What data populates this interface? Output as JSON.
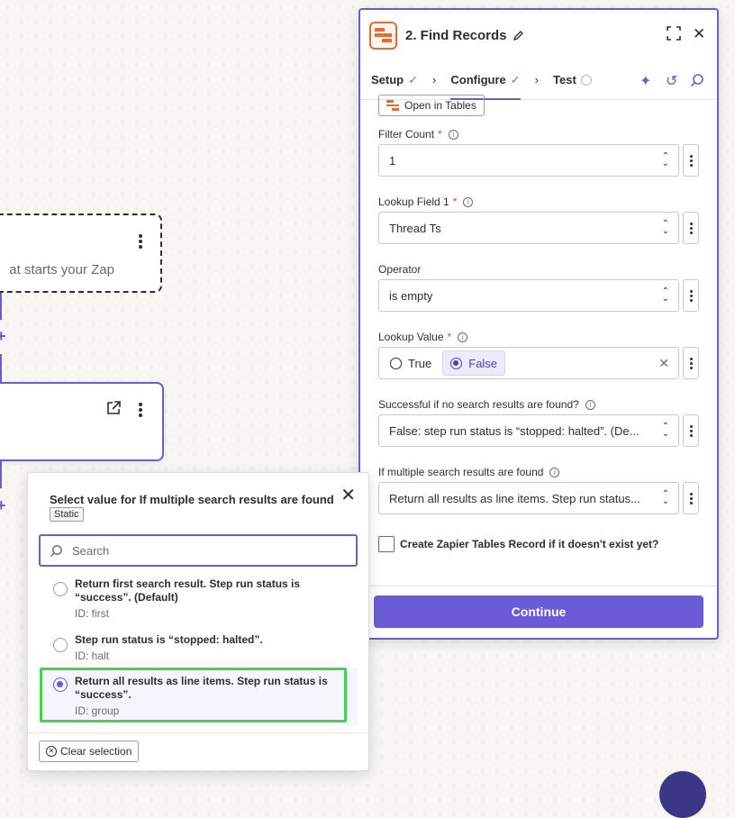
{
  "canvas": {
    "trigger_text": "at starts your Zap"
  },
  "panel": {
    "title": "2. Find Records",
    "tabs": {
      "setup": "Setup",
      "configure": "Configure",
      "test": "Test"
    },
    "open_in_tables": "Open in Tables",
    "fields": {
      "filter_count": {
        "label": "Filter Count",
        "value": "1"
      },
      "lookup_field": {
        "label": "Lookup Field 1",
        "value": "Thread Ts"
      },
      "operator": {
        "label": "Operator",
        "value": "is empty"
      },
      "lookup_value": {
        "label": "Lookup Value",
        "opt_true": "True",
        "opt_false": "False"
      },
      "no_results": {
        "label": "Successful if no search results are found?",
        "value": "False: step run status is “stopped: halted”. (De..."
      },
      "multiple_results": {
        "label": "If multiple search results are found",
        "value": "Return all results as line items. Step run status..."
      },
      "create_record": {
        "label": "Create Zapier Tables Record if it doesn't exist yet?"
      }
    },
    "continue_label": "Continue"
  },
  "popover": {
    "title": "Select value for If multiple search results are found",
    "badge": "Static",
    "search_placeholder": "Search",
    "options": [
      {
        "text": "Return first search result. Step run status is “success”. (Default)",
        "id": "ID: first"
      },
      {
        "text": "Step run status is “stopped: halted”.",
        "id": "ID: halt"
      },
      {
        "text": "Return all results as line items. Step run status is “success”.",
        "id": "ID: group"
      }
    ],
    "clear_label": "Clear selection"
  }
}
